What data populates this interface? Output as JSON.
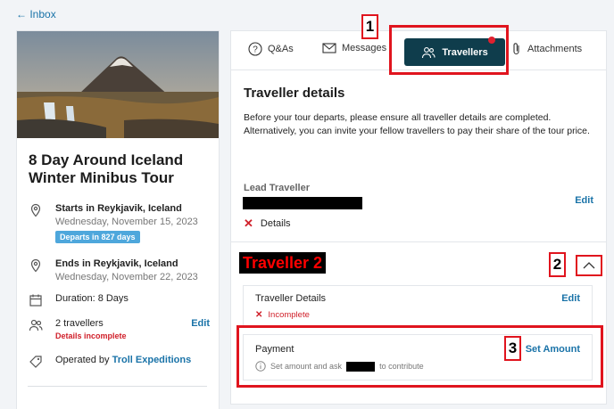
{
  "nav": {
    "back_label": "← Inbox"
  },
  "tour": {
    "title": "8 Day Around Iceland Winter Minibus Tour",
    "start_label": "Starts in Reykjavik, Iceland",
    "start_date": "Wednesday, November 15, 2023",
    "departs_badge": "Departs in 827 days",
    "end_label": "Ends in Reykjavik, Iceland",
    "end_date": "Wednesday, November 22, 2023",
    "duration": "Duration: 8 Days",
    "travellers": "2 travellers",
    "travellers_edit": "Edit",
    "travellers_status": "Details incomplete",
    "operated_prefix": "Operated by",
    "operator": "Troll Expeditions"
  },
  "tabs": {
    "qa": "Q&As",
    "messages": "Messages",
    "travellers": "Travellers",
    "attachments": "Attachments"
  },
  "traveller_details": {
    "title": "Traveller details",
    "description": "Before your tour departs, please ensure all traveller details are completed. Alternatively, you can invite your fellow travellers to pay their share of the tour price.",
    "lead_label": "Lead Traveller",
    "lead_edit": "Edit",
    "details_label": "Details"
  },
  "traveller2": {
    "banner": "Traveller 2",
    "details_label": "Traveller Details",
    "details_edit": "Edit",
    "status": "Incomplete",
    "payment_label": "Payment",
    "set_amount": "Set Amount",
    "payment_hint_prefix": "Set amount and ask",
    "payment_hint_suffix": "to contribute"
  },
  "annotations": {
    "n1": "1",
    "n2": "2",
    "n3": "3"
  },
  "colors": {
    "accent": "#1a73a8",
    "active_tab": "#0f3d4c",
    "badge": "#4ea7dc",
    "error": "#d0202a",
    "annotation": "#e0141e"
  }
}
